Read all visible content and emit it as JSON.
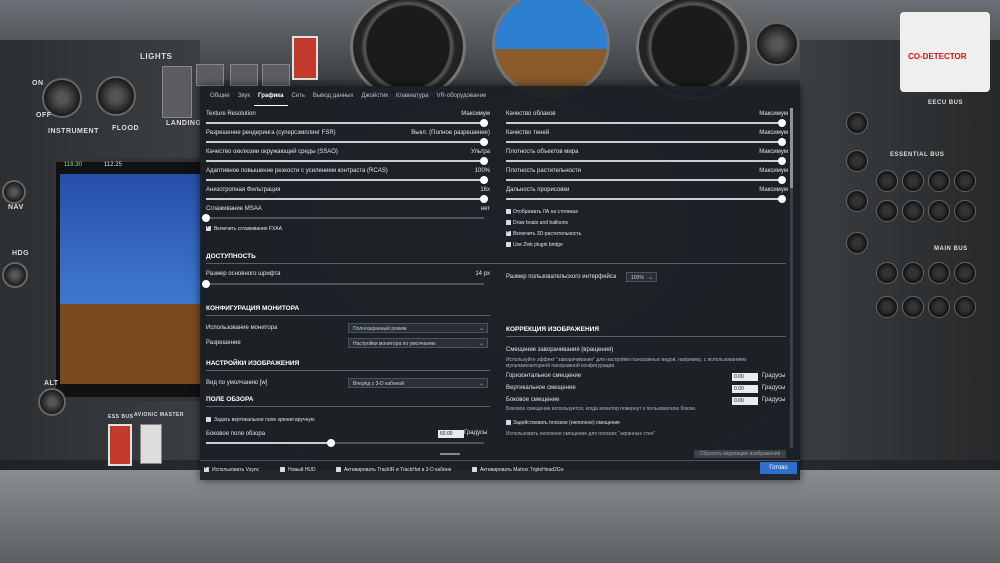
{
  "cockpit": {
    "lights_label": "LIGHTS",
    "instrument_label": "INSTRUMENT",
    "flood_label": "FLOOD",
    "off_label": "OFF",
    "on_label": "ON",
    "landing_label": "LANDING",
    "nav_label": "NAV",
    "hdg_label": "HDG",
    "alt_label": "ALT",
    "ess_bus_label": "ESS BUS",
    "avionic_master_label": "AVIONIC MASTER",
    "co_detector_label": "CO-DETECTOR",
    "eecu_bus_label": "EECU BUS",
    "essential_bus_label": "ESSENTIAL BUS",
    "main_bus_label": "MAIN BUS",
    "pfd_readout_1": "118.30",
    "pfd_readout_2": "112.25"
  },
  "tabs": [
    {
      "label": "Общие",
      "active": false
    },
    {
      "label": "Звук",
      "active": false
    },
    {
      "label": "Графика",
      "active": true
    },
    {
      "label": "Сеть",
      "active": false
    },
    {
      "label": "Вывод данных",
      "active": false
    },
    {
      "label": "Джойстик",
      "active": false
    },
    {
      "label": "Клавиатура",
      "active": false
    },
    {
      "label": "VR-оборудование",
      "active": false
    }
  ],
  "left_sliders": [
    {
      "label": "Texture Resolution",
      "value": "Максимум",
      "level": 1.0
    },
    {
      "label": "Разрешение рендеринга (суперсэмплинг FSR)",
      "value": "Выкл. (Полное разрешение)",
      "level": 1.0
    },
    {
      "label": "Качество окклюзии окружающей среды (SSAO)",
      "value": "Ультра",
      "level": 1.0
    },
    {
      "label": "Адаптивное повышение резкости с усилением контраста (RCAS)",
      "value": "100%",
      "level": 1.0
    },
    {
      "label": "Анизотропная Фильтрация",
      "value": "16x",
      "level": 1.0
    },
    {
      "label": "Сглаживание MSAA",
      "value": "нет",
      "level": 0.0
    }
  ],
  "fxaa_checkbox": {
    "label": "Включить сглаживание FXAA",
    "checked": true
  },
  "right_sliders": [
    {
      "label": "Качество облаков",
      "value": "Максимум",
      "level": 1.0
    },
    {
      "label": "Качество теней",
      "value": "Максимум",
      "level": 1.0
    },
    {
      "label": "Плотность объектов мира",
      "value": "Максимум",
      "level": 1.0
    },
    {
      "label": "Плотность растительности",
      "value": "Максимум",
      "level": 1.0
    },
    {
      "label": "Дальность прорисовки",
      "value": "Максимум",
      "level": 1.0
    }
  ],
  "right_checkboxes": [
    {
      "label": "Отображать ЛА на стоянках",
      "checked": false
    },
    {
      "label": "Draw boats and balloons",
      "checked": false
    },
    {
      "label": "Включить 3D-растительность",
      "checked": true
    },
    {
      "label": "Use Zink plugin bridge",
      "checked": false
    }
  ],
  "accessibility": {
    "title": "ДОСТУПНОСТЬ",
    "font_label": "Размер основного шрифта",
    "font_value": "14 px",
    "font_level": 0.0,
    "ui_scale_label": "Размер пользовательского интерфейса",
    "ui_scale_value": "100%"
  },
  "monitor": {
    "title": "КОНФИГУРАЦИЯ МОНИТОРА",
    "usage_label": "Использование монитора",
    "usage_value": "Полноэкранный режим",
    "resolution_label": "Разрешение",
    "resolution_value": "Настройки монитора по умолчанию"
  },
  "image_settings": {
    "title": "НАСТРОЙКИ ИЗОБРАЖЕНИЯ",
    "default_view_label": "Вид по умолчанию [w]",
    "default_view_value": "Вперёд с 3-D кабиной"
  },
  "fov": {
    "title": "ПОЛЕ ОБЗОРА",
    "manual_label": "Задать вертикальное поле зрения вручную",
    "manual_checked": false,
    "side_label": "Боковое поле обзора",
    "side_value": "60.00",
    "side_unit": "Градусы",
    "side_level": 0.45
  },
  "correction": {
    "title": "КОРРЕКЦИЯ ИЗОБРАЖЕНИЯ",
    "rotation_title": "Смещение заворачивания (вращения)",
    "rotation_desc_1": "Используйте эффект \"заворачивания\" для настройки панорамных видов, например, с использованием",
    "rotation_desc_2": "мультимониторной панорамной конфигурации.",
    "horizontal_label": "Горизонтальное смещение",
    "horizontal_value": "0.00",
    "vertical_label": "Вертикальное смещение",
    "vertical_value": "0.00",
    "lateral_label": "Боковое смещение",
    "lateral_value": "0.00",
    "unit": "Градусы",
    "lateral_desc": "Боковое смещение используется, когда монитор повернут к пользователю боком.",
    "flat_label": "Задействовать плоское (неполное) смещение",
    "flat_checked": false,
    "flat_desc": "Использовать неполное смещение для плоских \"экранных стен\"",
    "reset_label": "Сбросить коррекцию изображения"
  },
  "footer": {
    "checkboxes": [
      {
        "label": "Использовать Vsync",
        "checked": true
      },
      {
        "label": "Новый HUD",
        "checked": false
      },
      {
        "label": "Активировать TrackIR и TrackHat в 3-D кабине",
        "checked": false
      },
      {
        "label": "Активировать Matrox TripleHead2Go",
        "checked": false
      }
    ],
    "ok_label": "Готово"
  }
}
